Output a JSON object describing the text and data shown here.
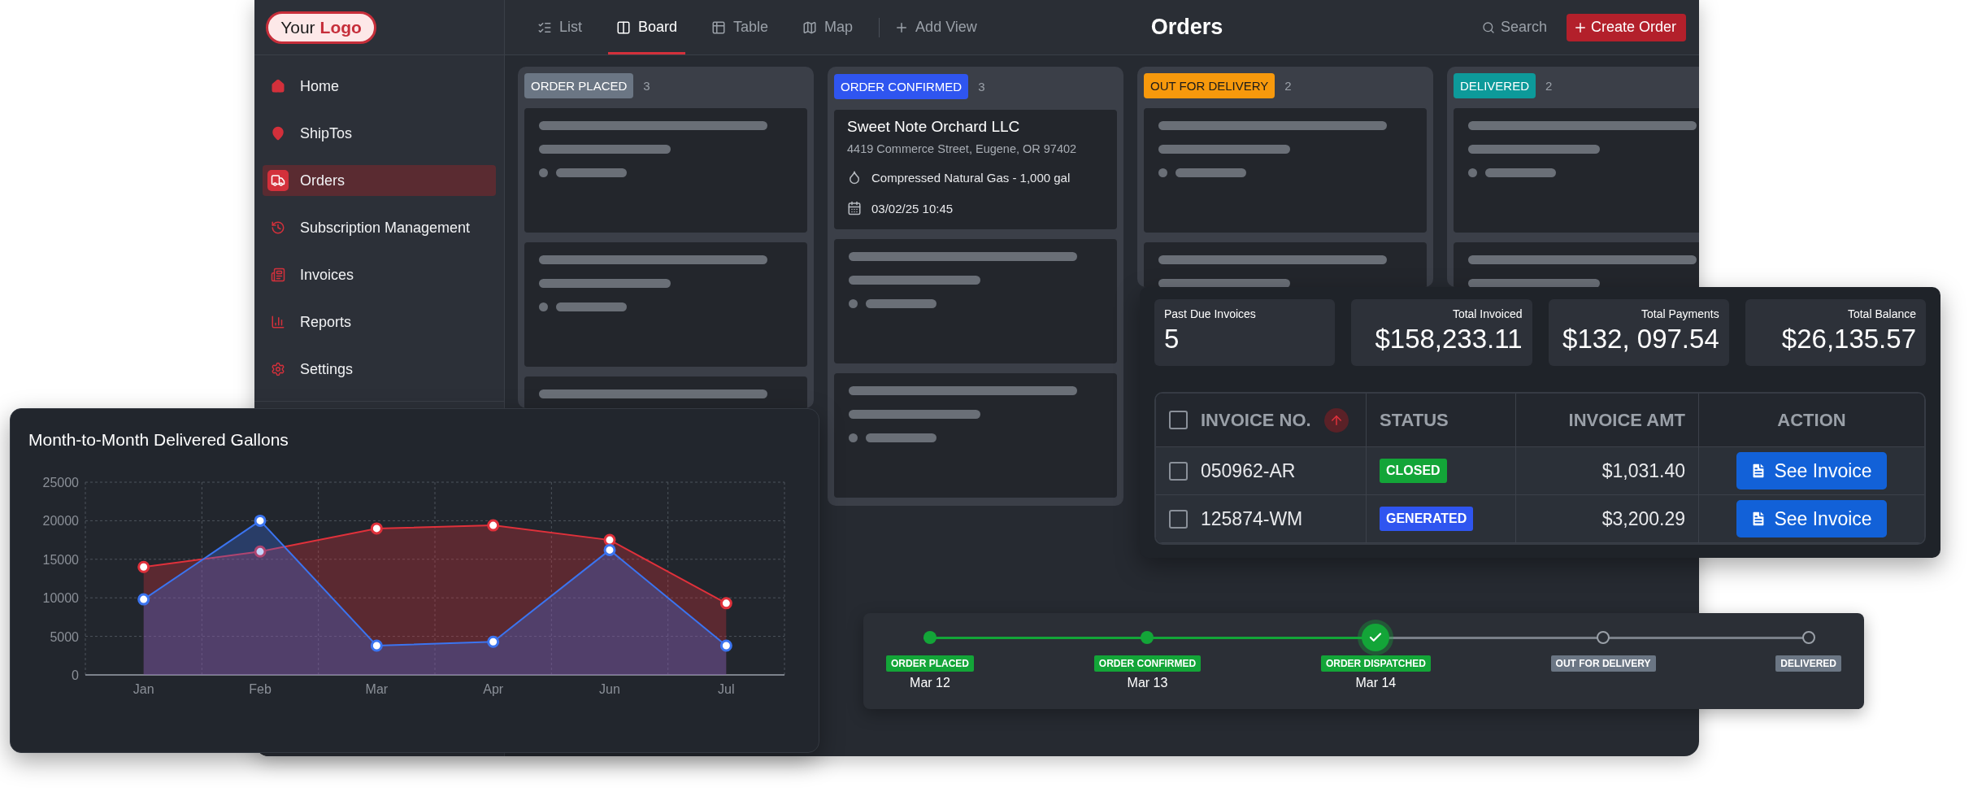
{
  "logo": {
    "text": "Your",
    "emphasis": "Logo"
  },
  "sidebar": {
    "items": [
      {
        "label": "Home",
        "selected": false
      },
      {
        "label": "ShipTos",
        "selected": false
      },
      {
        "label": "Orders",
        "selected": true
      },
      {
        "label": "Subscription Management",
        "selected": false
      },
      {
        "label": "Invoices",
        "selected": false
      },
      {
        "label": "Reports",
        "selected": false
      },
      {
        "label": "Settings",
        "selected": false
      }
    ]
  },
  "view_tabs": [
    {
      "label": "List",
      "selected": false
    },
    {
      "label": "Board",
      "selected": true
    },
    {
      "label": "Table",
      "selected": false
    },
    {
      "label": "Map",
      "selected": false
    }
  ],
  "add_view": "Add View",
  "title": "Orders",
  "search": {
    "placeholder": "Search"
  },
  "create_button": "Create Order",
  "board": {
    "columns": [
      {
        "label": "ORDER PLACED",
        "count": "3",
        "color": "#6b7684",
        "cards": [
          {
            "kind": "placeholder"
          },
          {
            "kind": "placeholder"
          },
          {
            "kind": "placeholder"
          }
        ]
      },
      {
        "label": "ORDER CONFIRMED",
        "count": "3",
        "color": "#2f55f0",
        "cards": [
          {
            "kind": "order",
            "customer": "Sweet Note Orchard LLC",
            "address": "4419 Commerce Street, Eugene, OR 97402",
            "product": "Compressed Natural Gas - 1,000 gal",
            "datetime": "03/02/25 10:45"
          },
          {
            "kind": "placeholder"
          },
          {
            "kind": "placeholder"
          }
        ]
      },
      {
        "label": "OUT FOR DELIVERY",
        "count": "2",
        "color": "#f7990c",
        "cards": [
          {
            "kind": "placeholder"
          },
          {
            "kind": "placeholder"
          }
        ]
      },
      {
        "label": "DELIVERED",
        "count": "2",
        "color": "#0d9a9a",
        "cards": [
          {
            "kind": "placeholder"
          },
          {
            "kind": "placeholder"
          }
        ]
      }
    ]
  },
  "chart": {
    "chart_data": {
      "type": "area",
      "title": "Month-to-Month Delivered Gallons",
      "categories": [
        "Jan",
        "Feb",
        "Mar",
        "Apr",
        "Jun",
        "Jul"
      ],
      "series": [
        {
          "color": "#e0313b",
          "values": [
            14000,
            16000,
            19000,
            19400,
            17500,
            9300
          ]
        },
        {
          "color": "#3b74f0",
          "values": [
            9800,
            20000,
            3800,
            4300,
            16200,
            3800
          ]
        }
      ],
      "grid": true,
      "ylim": [
        0,
        25000
      ],
      "yticks": [
        0,
        5000,
        10000,
        15000,
        20000,
        25000
      ]
    }
  },
  "invoice_summary": {
    "stats": [
      {
        "label": "Past Due Invoices",
        "value": "5"
      },
      {
        "label": "Total Invoiced",
        "value": "$158,233.11"
      },
      {
        "label": "Total Payments",
        "value": "$132, 097.54"
      },
      {
        "label": "Total Balance",
        "value": "$26,135.57"
      }
    ]
  },
  "invoice_table": {
    "columns": [
      "INVOICE NO.",
      "STATUS",
      "INVOICE AMT",
      "ACTION"
    ],
    "header_checked": false,
    "sorted_ascending": true,
    "rows": [
      {
        "checked": false,
        "invoice_no": "050962-AR",
        "status": "CLOSED",
        "color": "#13a538",
        "amount": "$1,031.40",
        "action": "See Invoice"
      },
      {
        "checked": false,
        "invoice_no": "125874-WM",
        "status": "GENERATED",
        "color": "#2f55f0",
        "amount": "$3,200.29",
        "action": "See Invoice"
      }
    ]
  },
  "timeline": {
    "steps": [
      {
        "label": "ORDER PLACED",
        "date": "Mar 12",
        "completed": true,
        "current": false
      },
      {
        "label": "ORDER CONFIRMED",
        "date": "Mar 13",
        "completed": true,
        "current": false
      },
      {
        "label": "ORDER DISPATCHED",
        "date": "Mar 14",
        "completed": true,
        "current": true
      },
      {
        "label": "OUT FOR DELIVERY",
        "completed": false,
        "current": false
      },
      {
        "label": "DELIVERED",
        "completed": false,
        "current": false
      }
    ]
  }
}
